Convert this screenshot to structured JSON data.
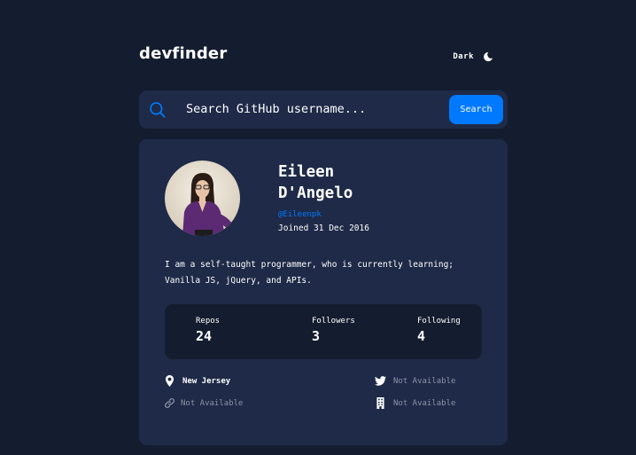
{
  "app": {
    "logo": "devfinder",
    "theme_label": "Dark"
  },
  "search": {
    "placeholder": "Search GitHub username...",
    "button_label": "Search"
  },
  "profile": {
    "name": "Eileen D'Angelo",
    "login": "@Eileenpk",
    "joined": "Joined 31 Dec 2016",
    "bio": "I am a self-taught programmer, who is currently learning; Vanilla JS, jQuery, and APIs."
  },
  "stats": [
    {
      "label": "Repos",
      "value": "24"
    },
    {
      "label": "Followers",
      "value": "3"
    },
    {
      "label": "Following",
      "value": "4"
    }
  ],
  "links": {
    "location": "New Jersey",
    "twitter": "Not Available",
    "blog": "Not Available",
    "company": "Not Available"
  },
  "colors": {
    "background": "#141d2f",
    "card": "#1e2a47",
    "accent": "#0079ff",
    "muted": "#8b93a8"
  }
}
